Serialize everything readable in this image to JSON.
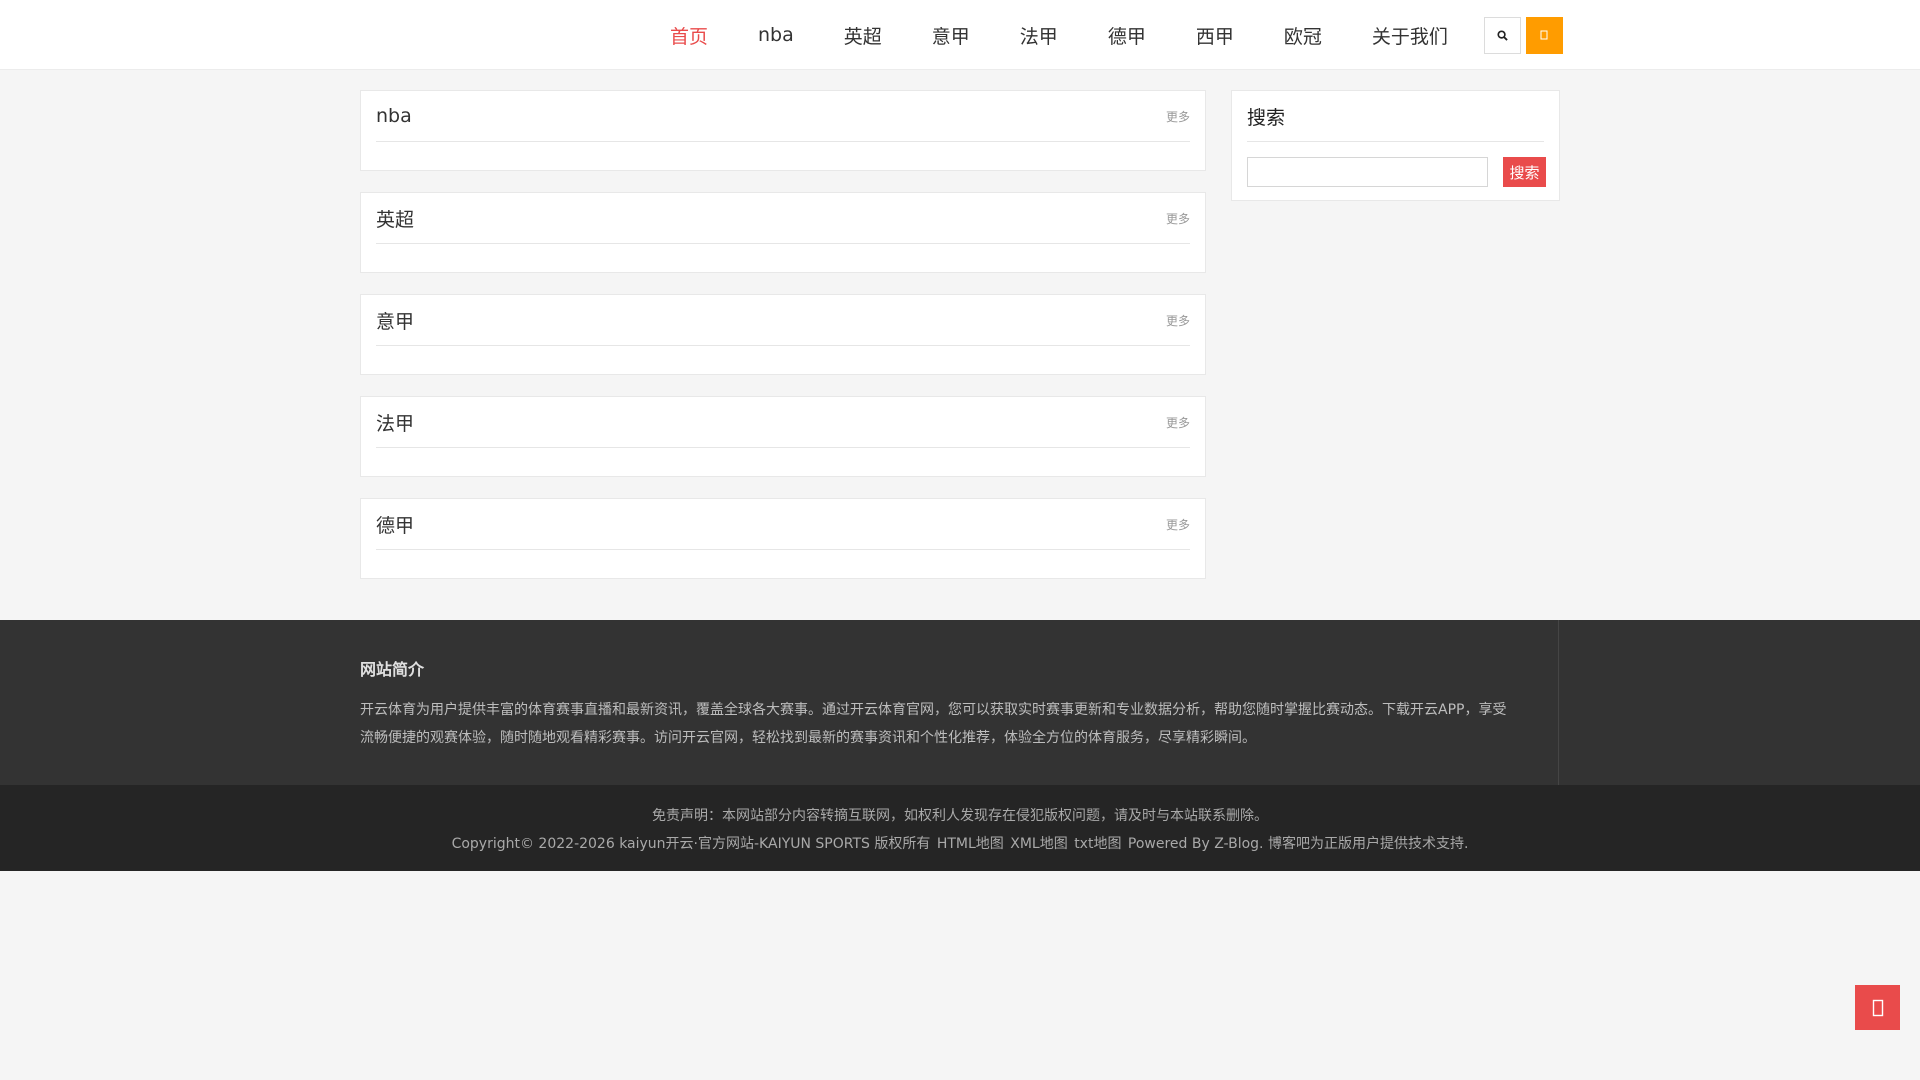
{
  "nav": {
    "items": [
      {
        "label": "首页",
        "active": true
      },
      {
        "label": "nba",
        "active": false
      },
      {
        "label": "英超",
        "active": false
      },
      {
        "label": "意甲",
        "active": false
      },
      {
        "label": "法甲",
        "active": false
      },
      {
        "label": "德甲",
        "active": false
      },
      {
        "label": "西甲",
        "active": false
      },
      {
        "label": "欧冠",
        "active": false
      },
      {
        "label": "关于我们",
        "active": false
      }
    ],
    "search_icon": "search-icon",
    "menu_icon": "menu-icon"
  },
  "panels": [
    {
      "title": "nba",
      "more": "更多"
    },
    {
      "title": "英超",
      "more": "更多"
    },
    {
      "title": "意甲",
      "more": "更多"
    },
    {
      "title": "法甲",
      "more": "更多"
    },
    {
      "title": "德甲",
      "more": "更多"
    }
  ],
  "sidebar": {
    "title": "搜索",
    "input_value": "",
    "button_label": "搜索"
  },
  "footer": {
    "intro_title": "网站简介",
    "intro_text": "开云体育为用户提供丰富的体育赛事直播和最新资讯，覆盖全球各大赛事。通过开云体育官网，您可以获取实时赛事更新和专业数据分析，帮助您随时掌握比赛动态。下载开云APP，享受流畅便捷的观赛体验，随时随地观看精彩赛事。访问开云官网，轻松找到最新的赛事资讯和个性化推荐，体验全方位的体育服务，尽享精彩瞬间。",
    "disclaimer": "免责声明：本网站部分内容转摘互联网，如权利人发现存在侵犯版权问题，请及时与本站联系删除。",
    "copyright_prefix": "Copyright© 2022-2026 kaiyun开云·官方网站-KAIYUN SPORTS 版权所有",
    "link_html_map": "HTML地图",
    "link_xml_map": "XML地图",
    "link_txt_map": "txt地图",
    "powered": "Powered By Z-Blog. 博客吧为正版用户提供技术支持."
  },
  "colors": {
    "accent_red": "#e94b4b",
    "accent_orange": "#ff9c00",
    "footer_dark": "#333333",
    "footer_darker": "#252525"
  },
  "back_to_top_icon": "arrow-up-icon"
}
